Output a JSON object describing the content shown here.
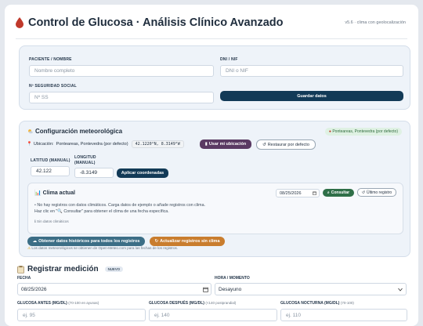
{
  "header": {
    "title": "Control de Glucosa · Análisis Clínico Avanzado",
    "version": "v5.6 · clima con geolocalización"
  },
  "patient": {
    "name_label": "PACIENTE / NOMBRE",
    "name_placeholder": "Nombre completo",
    "dni_label": "DNI / NIF",
    "dni_placeholder": "DNI o NIF",
    "ss_label": "Nº SEGURIDAD SOCIAL",
    "ss_placeholder": "Nº SS",
    "save_button": "Guardar datos"
  },
  "meteo": {
    "title": "Configuración meteorológica",
    "location_badge": "Ponteareas, Pontevedra (por defecto)",
    "location_label": "Ubicación:",
    "location_value": "Ponteareas, Pontevedra (por defecto)",
    "coords_chip": "42.1220°N, 8.3149°W",
    "use_location_button": "Usar mi ubicación",
    "restore_button": "Restaurar por defecto",
    "lat_label": "LATITUD (MANUAL)",
    "lat_value": "42.122",
    "lon_label_1": "LONGITUD",
    "lon_label_2": "(MANUAL)",
    "lon_value": "-8.3149",
    "apply_button": "Aplicar coordenadas",
    "clima": {
      "title": "Clima actual",
      "date_value": "08/25/2026",
      "consult_button": "Consultar",
      "last_record_button": "Último registro",
      "msg_line1": "No hay registros con datos climáticos. Carga datos de ejemplo o añade registros con clima.",
      "msg_line2": "Haz clic en \"🔍 Consultar\" para obtener el clima de una fecha específica.",
      "msg_line3": "Sin datos climáticos"
    },
    "historic_button": "Obtener datos históricos para todos los registros",
    "update_button": "Actualizar registros sin clima",
    "note": "Los datos meteorológicos se obtienen de Open-Meteo.com para las fechas de los registros."
  },
  "register": {
    "title": "Registrar medición",
    "badge": "NUEVO",
    "date_label": "FECHA",
    "date_value": "08/25/2026",
    "moment_label": "HORA / MOMENTO",
    "moment_value": "Desayuno",
    "before_label": "GLUCOSA ANTES (MG/DL)",
    "before_hint": "(70-100 en ayunas)",
    "before_placeholder": "ej. 95",
    "after_label": "GLUCOSA DESPUÉS (MG/DL)",
    "after_hint": "(<140 postprandial)",
    "after_placeholder": "ej. 140",
    "night_label": "GLUCOSA NOCTURNA (MG/DL)",
    "night_hint": "(70-100)",
    "night_placeholder": "ej. 110"
  },
  "colors": {
    "primary_dark": "#123a57",
    "purple": "#5a3a63",
    "green": "#2f6f48",
    "teal": "#3c6e86",
    "orange": "#c97d2e",
    "drop_red": "#c0392b"
  }
}
